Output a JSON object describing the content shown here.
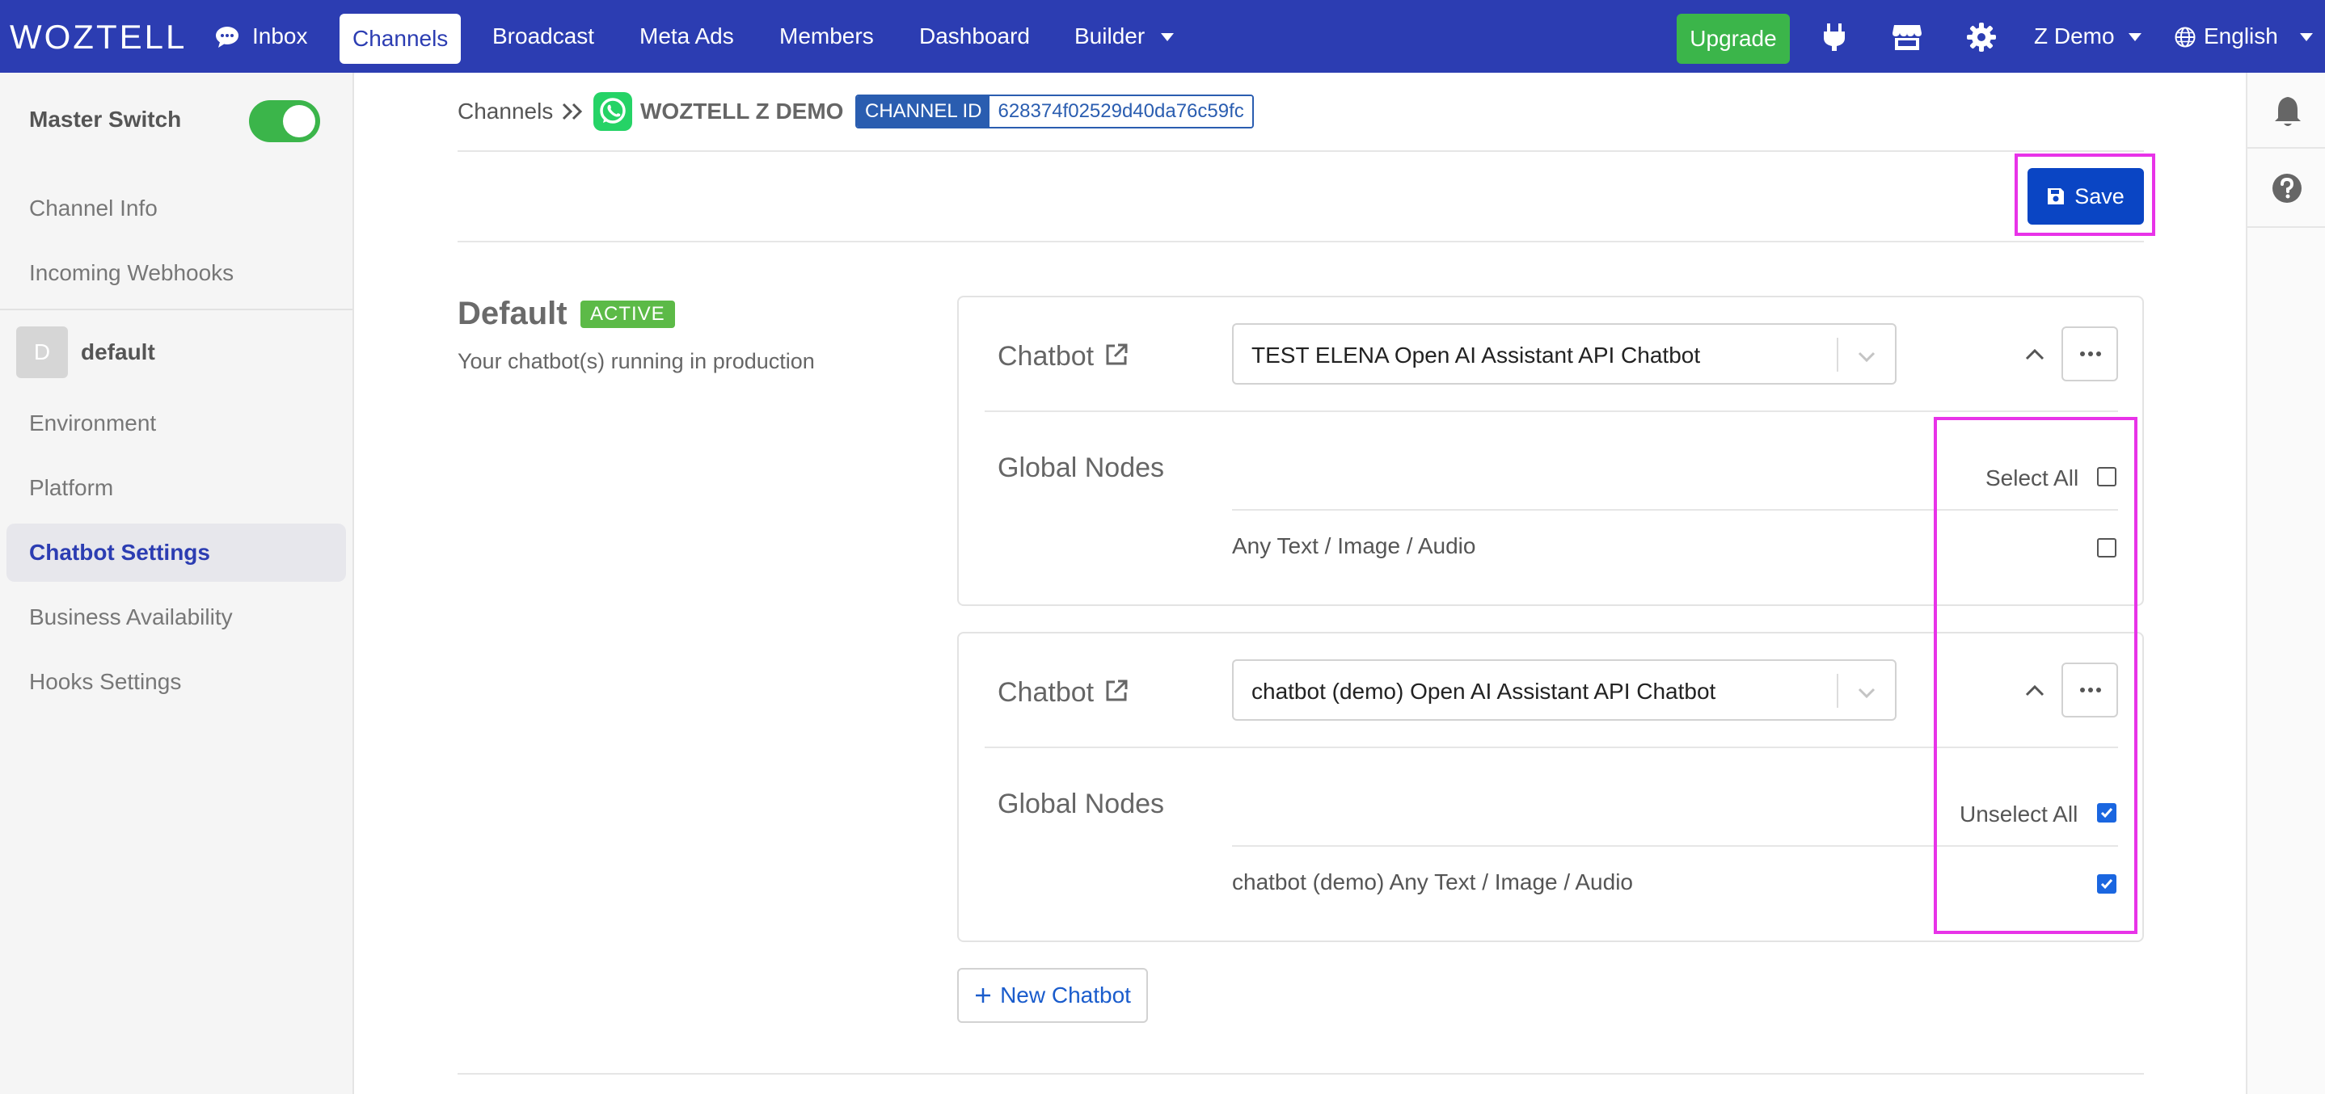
{
  "nav": {
    "brand": "WOZTELL",
    "items": [
      {
        "label": "Inbox"
      },
      {
        "label": "Channels"
      },
      {
        "label": "Broadcast"
      },
      {
        "label": "Meta Ads"
      },
      {
        "label": "Members"
      },
      {
        "label": "Dashboard"
      },
      {
        "label": "Builder"
      }
    ],
    "upgrade": "Upgrade",
    "user": "Z Demo",
    "language": "English"
  },
  "sidebar": {
    "master_switch": "Master Switch",
    "master_switch_on": true,
    "items": [
      {
        "label": "Channel Info"
      },
      {
        "label": "Incoming Webhooks"
      }
    ],
    "env_initial": "D",
    "env_name": "default",
    "env_items": [
      {
        "label": "Environment"
      },
      {
        "label": "Platform"
      },
      {
        "label": "Chatbot Settings",
        "active": true
      },
      {
        "label": "Business Availability"
      },
      {
        "label": "Hooks Settings"
      }
    ]
  },
  "breadcrumb": {
    "root": "Channels",
    "channel_name": "WOZTELL Z DEMO",
    "channel_id_label": "CHANNEL ID",
    "channel_id": "628374f02529d40da76c59fc"
  },
  "toolbar": {
    "save_label": "Save"
  },
  "section": {
    "title": "Default",
    "badge": "ACTIVE",
    "description": "Your chatbot(s) running in production"
  },
  "chatbots": [
    {
      "label": "Chatbot",
      "selected": "TEST ELENA Open AI Assistant API Chatbot",
      "global_nodes_label": "Global Nodes",
      "toggle_all_label": "Select All",
      "all_checked": false,
      "nodes": [
        {
          "label": "Any Text / Image / Audio",
          "checked": false
        }
      ]
    },
    {
      "label": "Chatbot",
      "selected": "chatbot (demo) Open AI Assistant API Chatbot",
      "global_nodes_label": "Global Nodes",
      "toggle_all_label": "Unselect All",
      "all_checked": true,
      "nodes": [
        {
          "label": "chatbot (demo) Any Text / Image / Audio",
          "checked": true
        }
      ]
    }
  ],
  "new_chatbot_label": "New Chatbot",
  "colors": {
    "nav_bg": "#2c3db2",
    "upgrade": "#3bb54a",
    "save": "#0a45c4",
    "active_badge": "#5cba47",
    "highlight": "#e833e8",
    "checkbox_on": "#1a66e0"
  }
}
